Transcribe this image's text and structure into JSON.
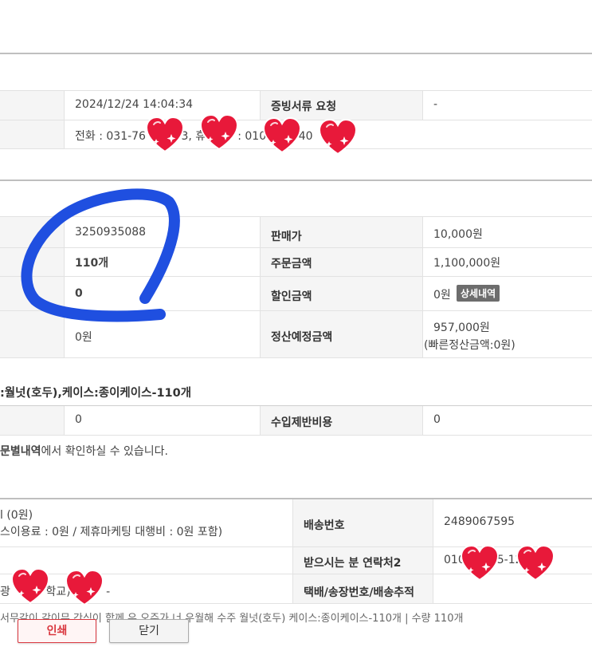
{
  "order_info": {
    "order_datetime": "2024/12/24 14:04:34",
    "receipt_request_label": "증빙서류 요청",
    "receipt_request_value": "-",
    "contact_text": "전화 : 031-76        03, 휴         : 010        -40"
  },
  "product": {
    "product_number": "3250935088",
    "quantity": "110개",
    "discount_value": "0",
    "extra_value": "0원",
    "price_label": "판매가",
    "price_value": "10,000원",
    "order_amount_label": "주문금액",
    "order_amount_value": "1,100,000원",
    "discount_amount_label": "할인금액",
    "discount_amount_value": "0원",
    "detail_badge": "상세내역",
    "settlement_label": "정산예정금액",
    "settlement_value": "957,000원",
    "settlement_sub": "(빠른정산금액:0원)"
  },
  "option_text": ":월넛(호두),케이스:종이케이스-110개",
  "import_row": {
    "left_value": "0",
    "import_cost_label": "수입제반비용",
    "import_cost_value": "0"
  },
  "note_text": {
    "bold_part": "문별내역",
    "rest": "에서 확인하실 수 있습니다."
  },
  "delivery": {
    "fee_line1": "l (0원)",
    "fee_line2": "스이용료 : 0원 / 제휴마케팅 대행비 : 0원 포함)",
    "shipping_no_label": "배송번호",
    "shipping_no_value": "2489067595",
    "contact2_label": "받으시는 분 연락처2",
    "contact2_value": "010         5-12",
    "address_partial": "광          학교)          -",
    "tracking_label": "택배/송장번호/배송추적",
    "memo_partial": "서무같이 같이무 간식이 함께 우 오주가 너 우월해 수주 월넛(호두) 케이스:종이케이스-110개 | 수량 110개"
  },
  "buttons": {
    "print_label": "인쇄",
    "close_label": "닫기"
  },
  "colors": {
    "heart_red": "#e8193a",
    "scribble_blue": "#1f4fe0",
    "print_border": "#d9363e"
  }
}
